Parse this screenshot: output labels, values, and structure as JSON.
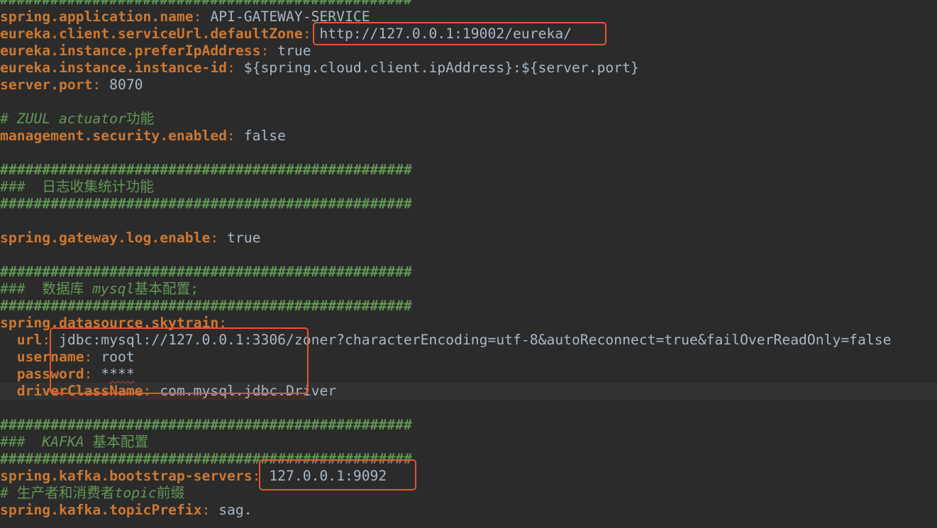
{
  "lines": [
    {
      "hash": "#################################################"
    },
    {
      "key": "spring.application.name",
      "sep": ": ",
      "value": "API-GATEWAY-SERVICE"
    },
    {
      "key": "eureka.client.serviceUrl.defaultZone",
      "sep": ": ",
      "value": "http://127.0.0.1:19002/eureka/"
    },
    {
      "key": "eureka.instance.preferIpAddress",
      "sep": ": ",
      "value": "true"
    },
    {
      "key": "eureka.instance.instance-id",
      "sep": ": ",
      "value": "${spring.cloud.client.ipAddress}:${server.port}"
    },
    {
      "key": "server.port",
      "sep": ": ",
      "value": "8070"
    },
    {
      "blank": ""
    },
    {
      "comment_hash": "# ",
      "comment_italic": "ZUUL actuator",
      "comment_rest": "功能"
    },
    {
      "key": "management.security.enabled",
      "sep": ": ",
      "value": "false"
    },
    {
      "blank": ""
    },
    {
      "hash": "#################################################"
    },
    {
      "comment_hash": "###  ",
      "comment_rest": "日志收集统计功能"
    },
    {
      "hash": "#################################################"
    },
    {
      "blank": ""
    },
    {
      "key": "spring.gateway.log.enable",
      "sep": ": ",
      "value": "true"
    },
    {
      "blank": ""
    },
    {
      "hash": "#################################################"
    },
    {
      "comment_hash": "###  ",
      "comment_rest": "数据库 ",
      "comment_italic2": "mysql",
      "comment_rest2": "基本配置;"
    },
    {
      "hash": "#################################################"
    },
    {
      "key": "spring.datasource.skytrain",
      "sep": ":",
      "value": ""
    },
    {
      "indent": "  ",
      "key": "url",
      "sep": ": ",
      "value": "jdbc:mysql://127.0.0.1:3306/zoner?characterEncoding=utf-8&autoReconnect=true&failOverReadOnly=false"
    },
    {
      "indent": "  ",
      "key": "username",
      "sep": ": ",
      "value": "root"
    },
    {
      "indent": "  ",
      "key": "password",
      "sep": ": ",
      "value_plain": "*",
      "value_squig": "***"
    },
    {
      "indent": "  ",
      "key": "driverClassName",
      "sep": ": ",
      "value": "com.mysql.jdbc.Driver",
      "current": true
    },
    {
      "blank": ""
    },
    {
      "hash": "#################################################"
    },
    {
      "comment_hash": "###  ",
      "comment_italic": "KAFKA",
      "comment_rest": " 基本配置"
    },
    {
      "hash": "#################################################"
    },
    {
      "key": "spring.kafka.bootstrap-servers",
      "sep": ": ",
      "value": "127.0.0.1:9092"
    },
    {
      "comment_hash": "# ",
      "comment_rest": "生产者和消费者",
      "comment_italic2": "topic",
      "comment_rest2": "前缀"
    },
    {
      "key": "spring.kafka.topicPrefix",
      "sep": ": ",
      "value": "sag."
    },
    {
      "blank": ""
    }
  ],
  "colors": {
    "background": "#2b2b2b",
    "current_line": "#323232",
    "key": "#cc7832",
    "value": "#a9b7c6",
    "comment": "#629755",
    "highlight_box": "#e8542d"
  }
}
